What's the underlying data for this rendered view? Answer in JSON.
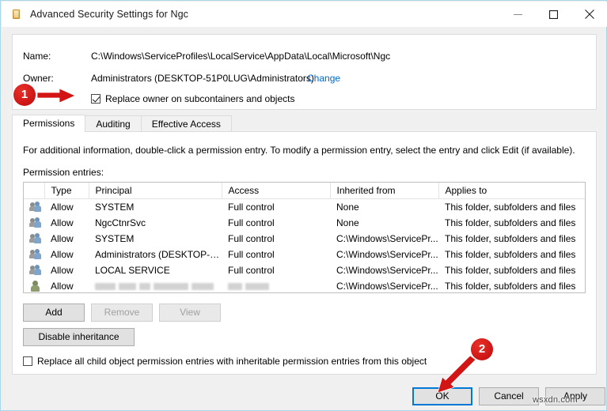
{
  "window": {
    "title": "Advanced Security Settings for Ngc",
    "icon": "folder-icon",
    "controls": {
      "minimize": "minimize-icon",
      "maximize": "maximize-icon",
      "close": "close-icon"
    }
  },
  "header": {
    "name_label": "Name:",
    "name_value": "C:\\Windows\\ServiceProfiles\\LocalService\\AppData\\Local\\Microsoft\\Ngc",
    "owner_label": "Owner:",
    "owner_value": "Administrators (DESKTOP-51P0LUG\\Administrators)",
    "change_link": "Change",
    "replace_owner_label": "Replace owner on subcontainers and objects",
    "replace_owner_checked": true
  },
  "tabs": [
    {
      "label": "Permissions",
      "active": true
    },
    {
      "label": "Auditing",
      "active": false
    },
    {
      "label": "Effective Access",
      "active": false
    }
  ],
  "main": {
    "info_text": "For additional information, double-click a permission entry. To modify a permission entry, select the entry and click Edit (if available).",
    "entries_label": "Permission entries:",
    "columns": [
      "",
      "Type",
      "Principal",
      "Access",
      "Inherited from",
      "Applies to"
    ],
    "rows": [
      {
        "icon": "group-icon",
        "type": "Allow",
        "principal": "SYSTEM",
        "access": "Full control",
        "inherited": "None",
        "applies": "This folder, subfolders and files",
        "redacted": false
      },
      {
        "icon": "group-icon",
        "type": "Allow",
        "principal": "NgcCtnrSvc",
        "access": "Full control",
        "inherited": "None",
        "applies": "This folder, subfolders and files",
        "redacted": false
      },
      {
        "icon": "group-icon",
        "type": "Allow",
        "principal": "SYSTEM",
        "access": "Full control",
        "inherited": "C:\\Windows\\ServicePr...",
        "applies": "This folder, subfolders and files",
        "redacted": false
      },
      {
        "icon": "group-icon",
        "type": "Allow",
        "principal": "Administrators (DESKTOP-51P...",
        "access": "Full control",
        "inherited": "C:\\Windows\\ServicePr...",
        "applies": "This folder, subfolders and files",
        "redacted": false
      },
      {
        "icon": "group-icon",
        "type": "Allow",
        "principal": "LOCAL SERVICE",
        "access": "Full control",
        "inherited": "C:\\Windows\\ServicePr...",
        "applies": "This folder, subfolders and files",
        "redacted": false
      },
      {
        "icon": "user-icon",
        "type": "Allow",
        "principal": "",
        "access": "",
        "inherited": "C:\\Windows\\ServicePr...",
        "applies": "This folder, subfolders and files",
        "redacted": true
      }
    ],
    "buttons": {
      "add": "Add",
      "remove": "Remove",
      "view": "View",
      "disable_inheritance": "Disable inheritance"
    },
    "buttons_enabled": {
      "add": true,
      "remove": false,
      "view": false,
      "disable_inheritance": true
    },
    "replace_all_label": "Replace all child object permission entries with inheritable permission entries from this object",
    "replace_all_checked": false
  },
  "footer": {
    "ok": "OK",
    "cancel": "Cancel",
    "apply": "Apply",
    "focused": "ok"
  },
  "annotations": [
    {
      "id": "1",
      "label": "1"
    },
    {
      "id": "2",
      "label": "2"
    }
  ],
  "watermark": "wsxdn.com",
  "colors": {
    "accent": "#0078d7",
    "link": "#0066cc",
    "annotation": "#cc1414",
    "window_border": "#a8d8e8"
  }
}
